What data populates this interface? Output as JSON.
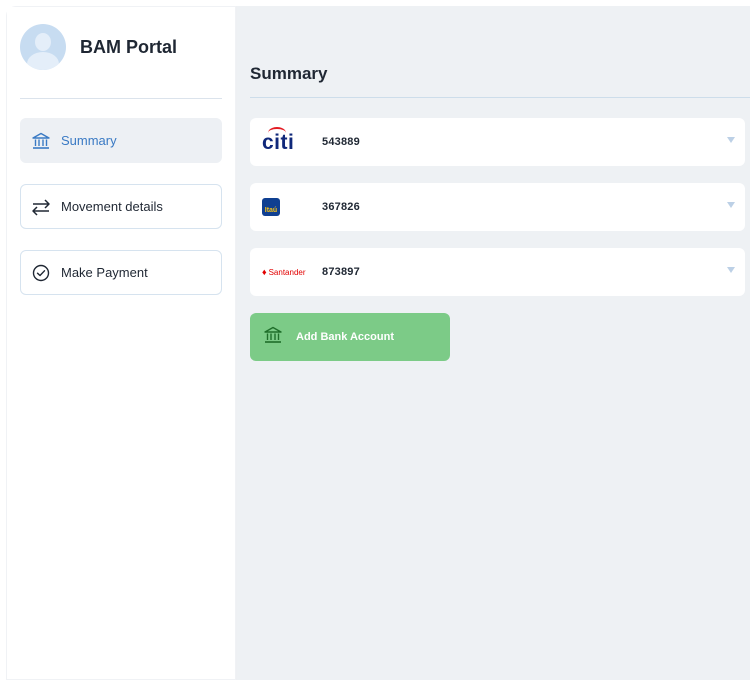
{
  "app": {
    "title": "BAM Portal"
  },
  "sidebar": {
    "items": [
      {
        "label": "Summary",
        "icon": "bank-icon",
        "active": true
      },
      {
        "label": "Movement details",
        "icon": "arrows-exchange-icon",
        "active": false
      },
      {
        "label": "Make Payment",
        "icon": "check-circle-icon",
        "active": false
      }
    ]
  },
  "main": {
    "title": "Summary",
    "accounts": [
      {
        "bank_logo_text": "citi",
        "number": "543889"
      },
      {
        "bank_logo_text": "Itaú",
        "number": "367826"
      },
      {
        "bank_logo_text": "Santander",
        "number": "873897"
      }
    ],
    "add_button_label": "Add Bank Account"
  },
  "colors": {
    "accent": "#3a7ac4",
    "add_button": "#7ccb87",
    "background": "#eef1f4"
  }
}
